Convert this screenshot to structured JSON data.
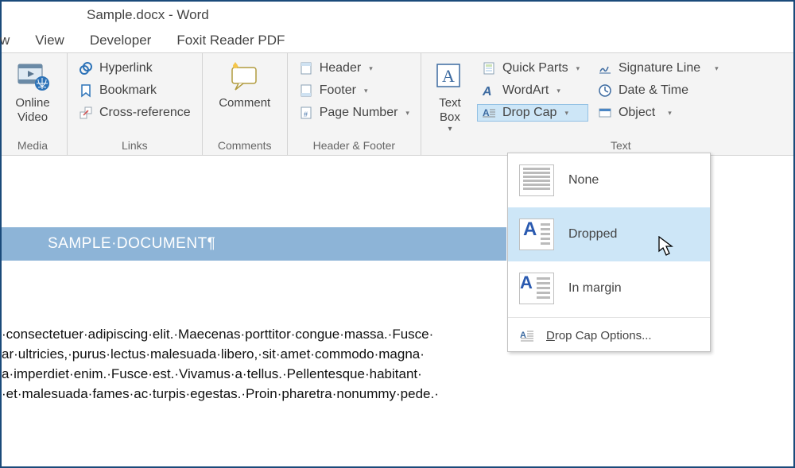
{
  "title": "Sample.docx - Word",
  "tabs": {
    "partial": "w",
    "view": "View",
    "developer": "Developer",
    "foxit": "Foxit Reader PDF"
  },
  "ribbon": {
    "media": {
      "label": "Media",
      "online_video": "Online\nVideo"
    },
    "links": {
      "label": "Links",
      "hyperlink": "Hyperlink",
      "bookmark": "Bookmark",
      "crossref": "Cross-reference"
    },
    "comments": {
      "label": "Comments",
      "comment": "Comment"
    },
    "hf": {
      "label": "Header & Footer",
      "header": "Header",
      "footer": "Footer",
      "pagenum": "Page Number"
    },
    "text": {
      "label": "Text",
      "textbox": "Text\nBox",
      "quickparts": "Quick Parts",
      "wordart": "WordArt",
      "dropcap": "Drop Cap",
      "sigline": "Signature Line",
      "datetime": "Date & Time",
      "object": "Object"
    }
  },
  "dropcap_menu": {
    "none": "None",
    "dropped": "Dropped",
    "inmargin": "In margin",
    "options": "Drop Cap Options..."
  },
  "doc": {
    "title_band": "SAMPLE·DOCUMENT¶",
    "l1": "·consectetuer·adipiscing·elit.·Maecenas·porttitor·congue·massa.·Fusce·",
    "l2": "ar·ultricies,·purus·lectus·malesuada·libero,·sit·amet·commodo·magna·",
    "l3": "a·imperdiet·enim.·Fusce·est.·Vivamus·a·tellus.·Pellentesque·habitant·",
    "l4": "·et·malesuada·fames·ac·turpis·egestas.·Proin·pharetra·nonummy·pede.·"
  }
}
